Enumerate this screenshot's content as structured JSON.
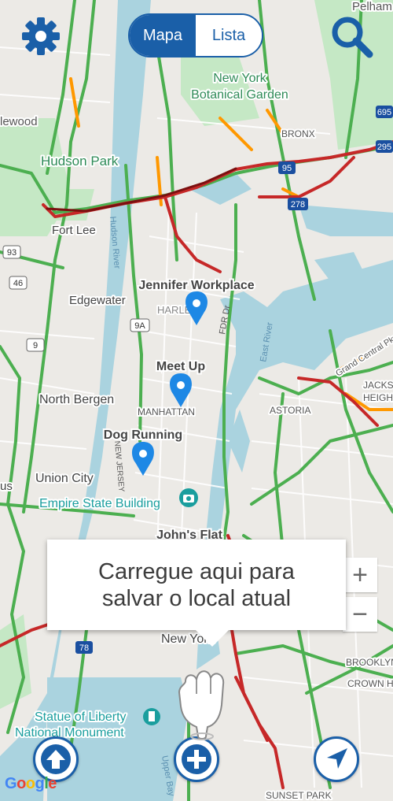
{
  "view_toggle": {
    "map_label": "Mapa",
    "list_label": "Lista",
    "active": "Mapa"
  },
  "tooltip": {
    "text": "Carregue aqui para salvar o local atual"
  },
  "zoom": {
    "in_label": "+",
    "out_label": "−"
  },
  "attribution": {
    "google": "Google"
  },
  "markers": {
    "jennifer": "Jennifer Workplace",
    "meetup": "Meet Up",
    "dog": "Dog Running",
    "johns": "John's Flat"
  },
  "map_labels": {
    "botanical_1": "New York",
    "botanical_2": "Botanical Garden",
    "pelham": "Pelham",
    "lewood": "lewood",
    "hudson_park": "Hudson Park",
    "bronx": "BRONX",
    "fort_lee": "Fort Lee",
    "hudson_river": "Hudson River",
    "edgewater": "Edgewater",
    "harlem": "HARLE",
    "fdr": "FDR Dr",
    "east_river": "East River",
    "grand_central": "Grand Central Pkwy",
    "jackson_1": "JACKS",
    "jackson_2": "HEIGH",
    "north_bergen": "North Bergen",
    "manhattan": "MANHATTAN",
    "astoria": "ASTORIA",
    "new_jersey": "NEW JERSEY",
    "union_city": "Union City",
    "us": "us",
    "empire": "Empire State Building",
    "new_york": "New York",
    "brooklyn": "BROOKLYN",
    "crown_1": "CROWN H",
    "statue_1": "Statue of Liberty",
    "statue_2": "National Monument",
    "upper_bay": "Upper Bay",
    "sunset_park": "SUNSET PARK"
  },
  "shields": {
    "i95": "95",
    "i278": "278",
    "r93": "93",
    "r46": "46",
    "r9": "9",
    "r9a": "9A",
    "i78": "78",
    "r695": "695",
    "r295": "295"
  },
  "colors": {
    "accent": "#1a5fa8",
    "marker": "#1e88e5",
    "water": "#aad3df",
    "park": "#c5e8c5",
    "traffic_green": "#4caf50",
    "traffic_red": "#c62828"
  }
}
